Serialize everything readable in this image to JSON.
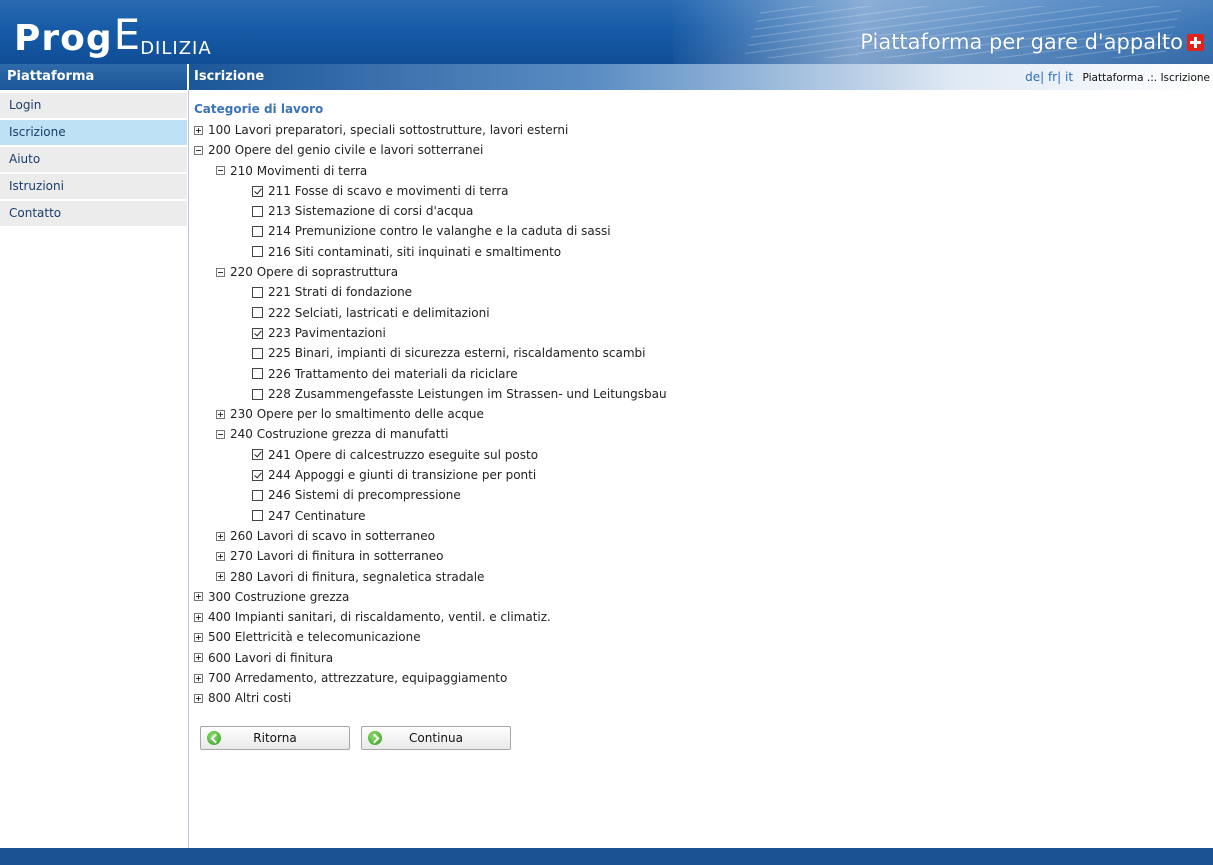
{
  "header": {
    "logo_prog": "Prog",
    "logo_e": "E",
    "logo_rest": "DILIZIA",
    "tagline": "Piattaforma per gare d'appalto"
  },
  "sidebar": {
    "title": "Piattaforma",
    "items": [
      {
        "label": "Login"
      },
      {
        "label": "Iscrizione",
        "active": true
      },
      {
        "label": "Aiuto"
      },
      {
        "label": "Istruzioni"
      },
      {
        "label": "Contatto"
      }
    ]
  },
  "topbar": {
    "title": "Iscrizione",
    "lang": [
      "de",
      "fr",
      "it"
    ],
    "breadcrumb": "Piattaforma .:. Iscrizione"
  },
  "main": {
    "section_title": "Categorie di lavoro",
    "tree": [
      {
        "label": "100 Lavori preparatori, speciali sottostrutture, lavori esterni",
        "level": 1,
        "kind": "toggle",
        "state": "plus"
      },
      {
        "label": "200 Opere del genio civile e lavori sotterranei",
        "level": 1,
        "kind": "toggle",
        "state": "minus"
      },
      {
        "label": "210 Movimenti di terra",
        "level": 2,
        "kind": "toggle",
        "state": "minus"
      },
      {
        "label": "211 Fosse di scavo e movimenti di terra",
        "level": 3,
        "kind": "check",
        "state": "on"
      },
      {
        "label": "213 Sistemazione di corsi d'acqua",
        "level": 3,
        "kind": "check",
        "state": "off"
      },
      {
        "label": "214 Premunizione contro le valanghe e la caduta di sassi",
        "level": 3,
        "kind": "check",
        "state": "off"
      },
      {
        "label": "216 Siti contaminati, siti inquinati e smaltimento",
        "level": 3,
        "kind": "check",
        "state": "off"
      },
      {
        "label": "220 Opere di soprastruttura",
        "level": 2,
        "kind": "toggle",
        "state": "minus"
      },
      {
        "label": "221 Strati di fondazione",
        "level": 3,
        "kind": "check",
        "state": "off"
      },
      {
        "label": "222 Selciati, lastricati e delimitazioni",
        "level": 3,
        "kind": "check",
        "state": "off"
      },
      {
        "label": "223 Pavimentazioni",
        "level": 3,
        "kind": "check",
        "state": "on"
      },
      {
        "label": "225 Binari, impianti di sicurezza esterni, riscaldamento scambi",
        "level": 3,
        "kind": "check",
        "state": "off"
      },
      {
        "label": "226 Trattamento dei materiali da riciclare",
        "level": 3,
        "kind": "check",
        "state": "off"
      },
      {
        "label": "228 Zusammengefasste Leistungen im Strassen- und Leitungsbau",
        "level": 3,
        "kind": "check",
        "state": "off"
      },
      {
        "label": "230 Opere per lo smaltimento delle acque",
        "level": 2,
        "kind": "toggle",
        "state": "plus"
      },
      {
        "label": "240 Costruzione grezza di manufatti",
        "level": 2,
        "kind": "toggle",
        "state": "minus"
      },
      {
        "label": "241 Opere di calcestruzzo eseguite sul posto",
        "level": 3,
        "kind": "check",
        "state": "on"
      },
      {
        "label": "244 Appoggi e giunti di transizione per ponti",
        "level": 3,
        "kind": "check",
        "state": "on"
      },
      {
        "label": "246 Sistemi di precompressione",
        "level": 3,
        "kind": "check",
        "state": "off"
      },
      {
        "label": "247 Centinature",
        "level": 3,
        "kind": "check",
        "state": "off"
      },
      {
        "label": "260 Lavori di scavo in sotterraneo",
        "level": 2,
        "kind": "toggle",
        "state": "plus"
      },
      {
        "label": "270 Lavori di finitura in sotterraneo",
        "level": 2,
        "kind": "toggle",
        "state": "plus"
      },
      {
        "label": "280 Lavori di finitura, segnaletica stradale",
        "level": 2,
        "kind": "toggle",
        "state": "plus"
      },
      {
        "label": "300 Costruzione grezza",
        "level": 1,
        "kind": "toggle",
        "state": "plus"
      },
      {
        "label": "400 Impianti sanitari, di riscaldamento, ventil. e climatiz.",
        "level": 1,
        "kind": "toggle",
        "state": "plus"
      },
      {
        "label": "500 Elettricità e telecomunicazione",
        "level": 1,
        "kind": "toggle",
        "state": "plus"
      },
      {
        "label": "600 Lavori di finitura",
        "level": 1,
        "kind": "toggle",
        "state": "plus"
      },
      {
        "label": "700 Arredamento, attrezzature, equipaggiamento",
        "level": 1,
        "kind": "toggle",
        "state": "plus"
      },
      {
        "label": "800 Altri costi",
        "level": 1,
        "kind": "toggle",
        "state": "plus"
      }
    ],
    "buttons": {
      "back_label": "Ritorna",
      "next_label": "Continua"
    }
  },
  "colors": {
    "header_blue": "#175ba7",
    "section_title": "#3a73b9",
    "sidebar_active": "#bfe1f6",
    "footer": "#1b5293",
    "swiss_red": "#e2231a"
  }
}
